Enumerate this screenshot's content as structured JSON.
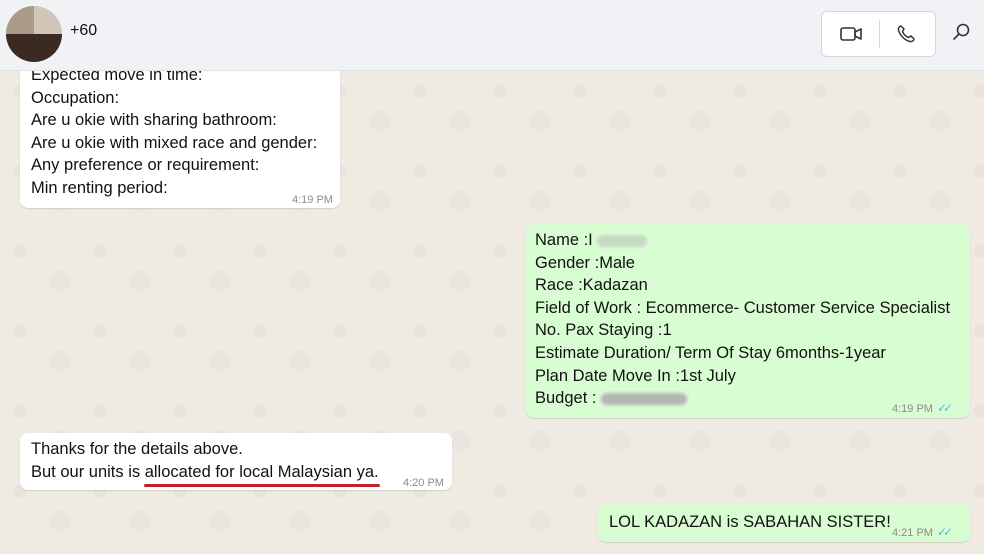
{
  "header": {
    "contact_name": "+60",
    "video_call_icon": "video-camera-icon",
    "voice_call_icon": "phone-icon",
    "search_icon": "search-icon"
  },
  "messages": [
    {
      "direction": "incoming",
      "lines": [
        "Expected move in time:",
        "Occupation:",
        "Are u okie with sharing bathroom:",
        "Are u okie with mixed race and gender:",
        "Any preference or requirement:",
        "Min renting period:"
      ],
      "time": "4:19 PM"
    },
    {
      "direction": "outgoing",
      "lines": [
        "Name :I",
        "Gender :Male",
        "Race :Kadazan",
        "Field of Work : Ecommerce- Customer Service Specialist",
        "No. Pax Staying :1",
        "Estimate Duration/ Term Of Stay 6months-1year",
        "Plan Date Move In :1st July",
        "Budget :"
      ],
      "time": "4:19 PM",
      "read": "✓✓"
    },
    {
      "direction": "incoming",
      "lines": [
        "Thanks for the details above.",
        "But our units is allocated for local Malaysian ya."
      ],
      "time": "4:20 PM"
    },
    {
      "direction": "outgoing",
      "lines": [
        "LOL KADAZAN is SABAHAN SISTER!"
      ],
      "time": "4:21 PM",
      "read": "✓✓"
    }
  ],
  "colors": {
    "incoming_bubble": "#ffffff",
    "outgoing_bubble": "#d9fdd3",
    "read_ticks": "#53bdeb",
    "annotation_underline": "#c0202c"
  }
}
